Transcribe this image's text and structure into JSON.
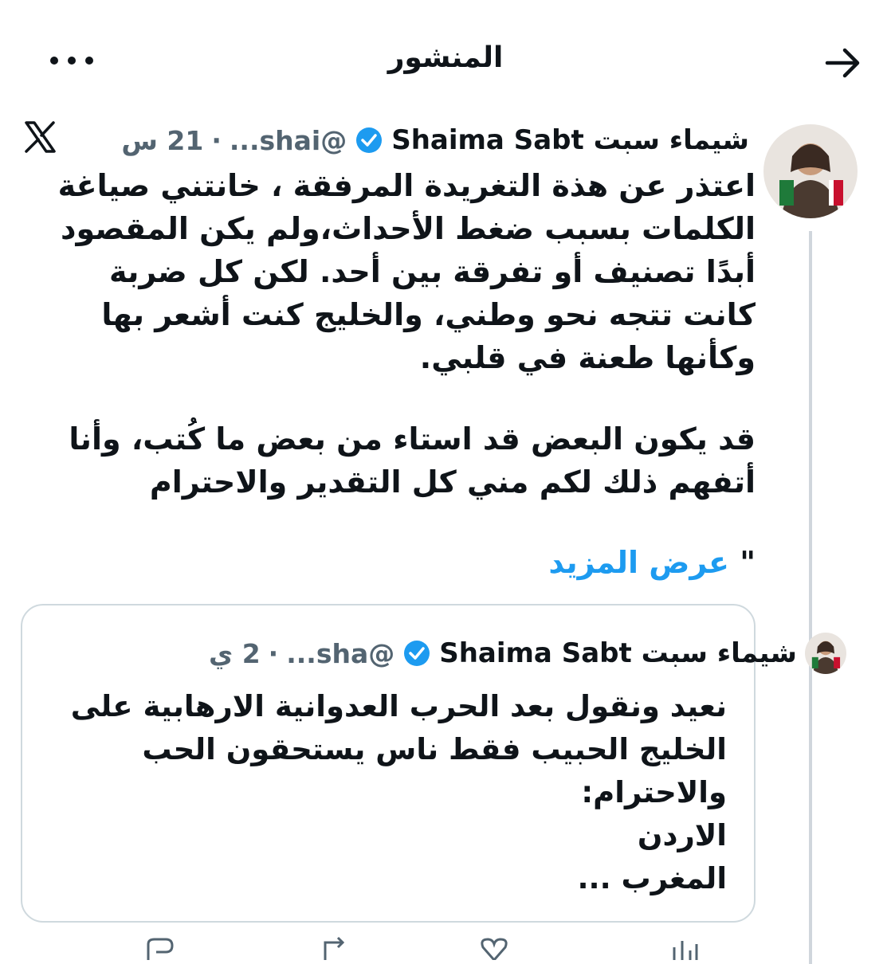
{
  "topbar": {
    "title": "المنشور"
  },
  "tweet": {
    "display_name": "شيماء سبت Shaima Sabt",
    "handle": "@shai...",
    "separator": "·",
    "time": "21 س",
    "body_p1": "اعتذر عن هذة التغريدة  المرفقة ، خانتني صياغة الكلمات بسبب ضغط الأحداث،ولم يكن المقصود أبدًا تصنيف أو تفرقة بين أحد. لكن كل ضربة كانت تتجه نحو وطني، والخليج كنت أشعر بها وكأنها طعنة في قلبي.",
    "body_p2": "قد يكون البعض قد استاء من بعض ما كُتب، وأنا أتفهم ذلك  لكم مني كل التقدير والاحترام",
    "quote_mark": "\"",
    "show_more": "عرض المزيد"
  },
  "quoted": {
    "display_name": "شيماء سبت Shaima Sabt",
    "handle": "@sha...",
    "separator": "·",
    "time": "2 ي",
    "line1": "نعيد ونقول بعد الحرب العدوانية الارهابية على الخليج الحبيب فقط ناس يستحقون الحب والاحترام:",
    "line2": "الاردن",
    "line3": "المغرب ..."
  },
  "icons": [
    "back-arrow-icon",
    "more-icon",
    "verified-badge-icon",
    "x-logo-icon"
  ],
  "colors": {
    "link": "#1d9bf0",
    "verified": "#1d9bf0",
    "muted": "#536471",
    "border": "#cfd9de"
  }
}
